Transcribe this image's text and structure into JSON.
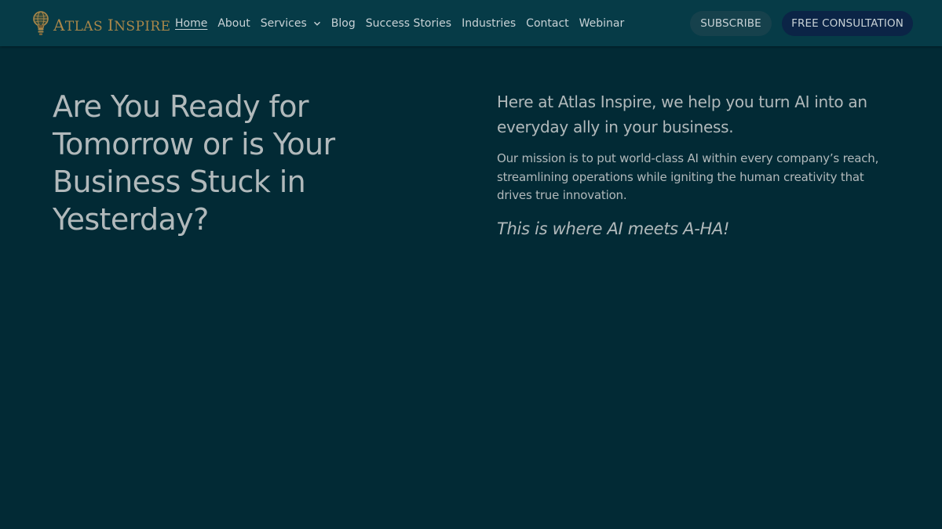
{
  "brand": {
    "logo_icon": "lightbulb-globe-icon",
    "name_first_initial": "A",
    "name_first_rest": "TLAS",
    "name_second_initial": "I",
    "name_second_rest": "NSPIRE",
    "color": "#a9874a"
  },
  "nav": {
    "items": [
      {
        "label": "Home",
        "active": true
      },
      {
        "label": "About"
      },
      {
        "label": "Services",
        "has_dropdown": true,
        "dropdown_icon": "chevron-down-icon"
      },
      {
        "label": "Blog"
      },
      {
        "label": "Success Stories"
      },
      {
        "label": "Industries"
      },
      {
        "label": "Contact"
      },
      {
        "label": "Webinar"
      }
    ]
  },
  "header_buttons": {
    "subscribe_label": "SUBSCRIBE",
    "consultation_label": "FREE CONSULTATION"
  },
  "hero": {
    "title": "Are You Ready for Tomorrow or is Your Business Stuck in Yesterday?",
    "intro": "Here at Atlas Inspire, we help you turn AI into an everyday ally in your business.",
    "mission": "Our mission is to put world-class AI within every company’s reach, streamlining operations while igniting the human creativity that drives true innovation.",
    "tagline": "This is where AI meets A-HA!"
  },
  "colors": {
    "page_background": "#022a35",
    "header_background": "#063b47",
    "text": "#b1b9bb",
    "subscribe_button": "#16414c",
    "consultation_button": "#0b2446"
  }
}
